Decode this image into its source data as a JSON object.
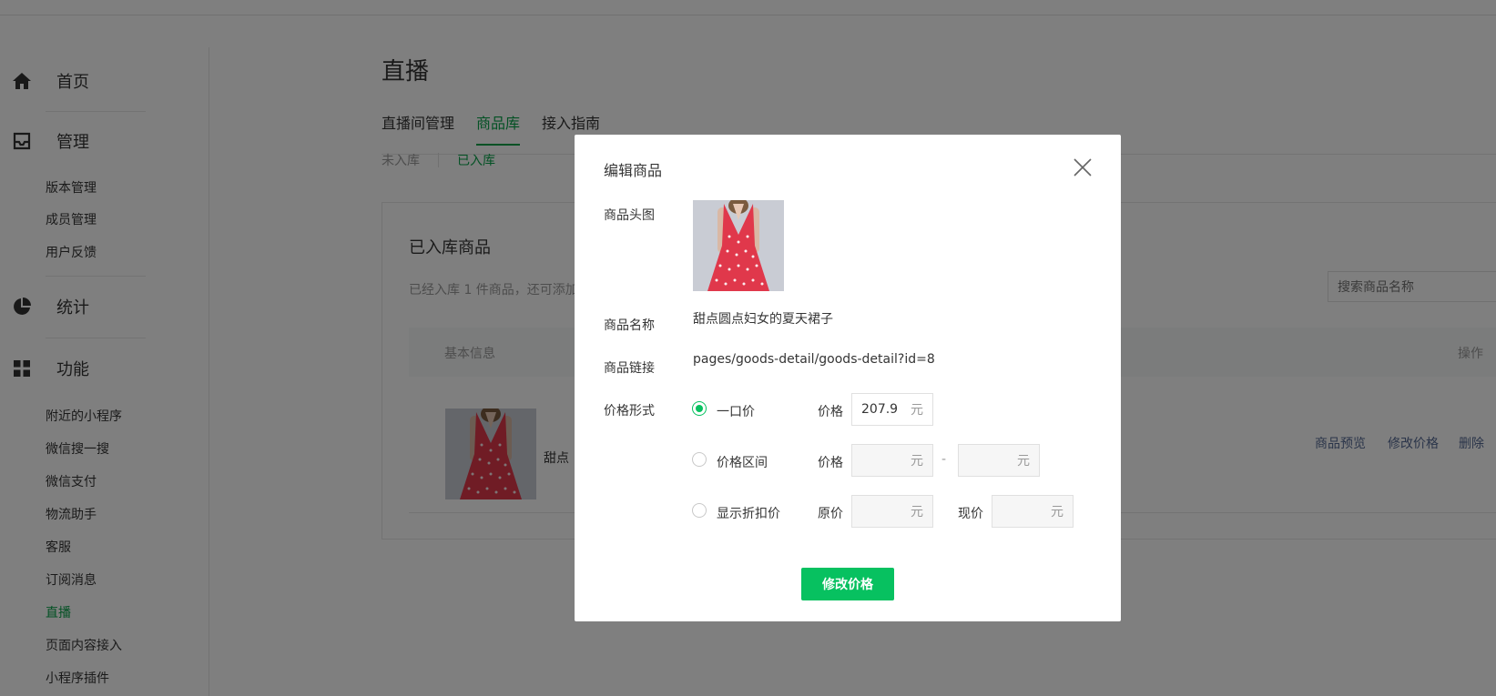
{
  "sidebar": {
    "home": {
      "label": "首页",
      "icon": "home-icon"
    },
    "manage": {
      "label": "管理",
      "icon": "inbox-icon",
      "items": [
        "版本管理",
        "成员管理",
        "用户反馈"
      ]
    },
    "stats": {
      "label": "统计",
      "icon": "pie-chart-icon"
    },
    "features": {
      "label": "功能",
      "icon": "grid-icon",
      "items": [
        "附近的小程序",
        "微信搜一搜",
        "微信支付",
        "物流助手",
        "客服",
        "订阅消息",
        "直播",
        "页面内容接入",
        "小程序插件"
      ],
      "active": "直播"
    }
  },
  "page": {
    "title": "直播",
    "tabs": [
      "直播间管理",
      "商品库",
      "接入指南"
    ],
    "active_tab": "商品库",
    "subtabs": [
      "未入库",
      "已入库"
    ],
    "active_subtab": "已入库"
  },
  "panel": {
    "title": "已入库商品",
    "desc": "已经入库 1 件商品，还可添加",
    "search_placeholder": "搜索商品名称",
    "columns": {
      "basic": "基本信息",
      "actions": "操作"
    },
    "row": {
      "name": "甜点",
      "actions": [
        "商品预览",
        "修改价格",
        "删除"
      ]
    }
  },
  "dialog": {
    "title": "编辑商品",
    "image_label": "商品头图",
    "name_label": "商品名称",
    "name_value": "甜点圆点妇女的夏天裙子",
    "link_label": "商品链接",
    "link_value": "pages/goods-detail/goods-detail?id=8",
    "price_form_label": "价格形式",
    "options": [
      {
        "label": "一口价",
        "checked": true
      },
      {
        "label": "价格区间",
        "checked": false
      },
      {
        "label": "显示折扣价",
        "checked": false
      }
    ],
    "price_label": "价格",
    "price_value": "207.9",
    "unit": "元",
    "range_dash": "-",
    "orig_price_label": "原价",
    "current_price_label": "现价",
    "submit_label": "修改价格"
  },
  "colors": {
    "accent": "#07c160",
    "active_text": "#07a349",
    "link": "#576b95",
    "overlay": "rgba(0,0,0,0.5)"
  }
}
